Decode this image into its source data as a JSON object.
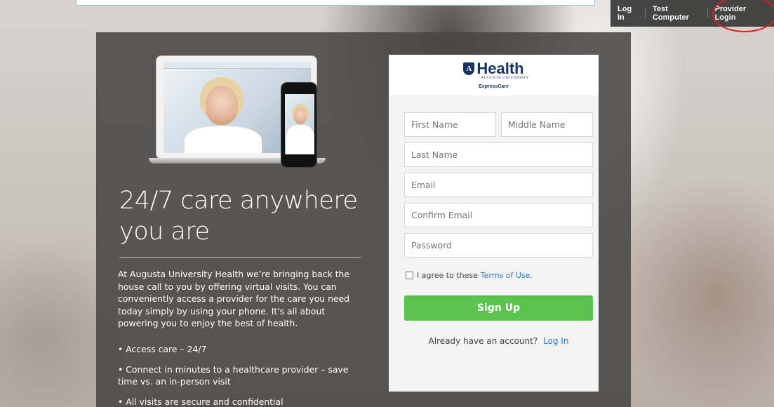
{
  "topnav": {
    "login_label": "Log In",
    "test_computer_label": "Test Computer",
    "provider_login_label": "Provider Login"
  },
  "logo": {
    "word": "Health",
    "shield_letter": "A",
    "subtitle": "AUGUSTA UNIVERSITY",
    "product": "ExpressCare"
  },
  "hero": {
    "headline": "24/7 care anywhere you are",
    "intro": "At Augusta University Health we’re bringing back the house call to you by offering virtual visits. You can conveniently access a provider for the care you need today simply by using your phone. It's all about powering you to enjoy the best of health.",
    "bullets": [
      "• Access care – 24/7",
      "• Connect in minutes to a healthcare provider – save time vs. an in-person visit",
      "• All visits are secure and confidential"
    ]
  },
  "signup_form": {
    "first_name_placeholder": "First Name",
    "middle_name_placeholder": "Middle Name",
    "last_name_placeholder": "Last Name",
    "email_placeholder": "Email",
    "confirm_email_placeholder": "Confirm Email",
    "password_placeholder": "Password",
    "terms_text": "I agree to these",
    "terms_link": "Terms of Use.",
    "submit_label": "Sign Up",
    "already_text": "Already have an account?",
    "login_link": "Log In"
  },
  "colors": {
    "brand_navy": "#14335f",
    "signup_green": "#5ac24f",
    "link_blue": "#2b78c5",
    "highlight_red": "#e21c24"
  }
}
